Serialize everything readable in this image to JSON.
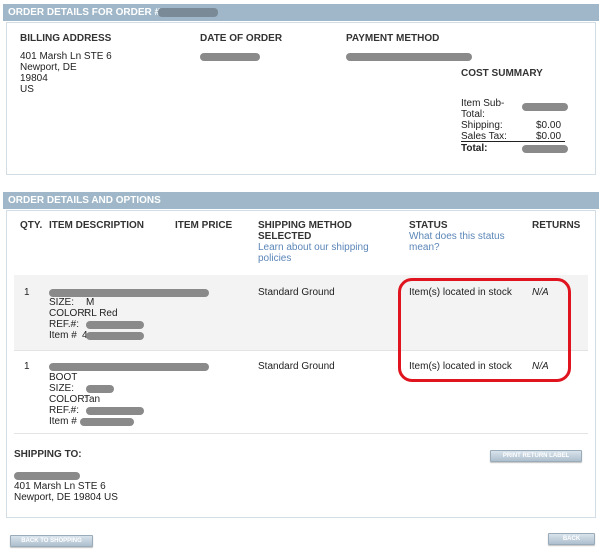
{
  "order_header": {
    "title": "ORDER DETAILS FOR ORDER #"
  },
  "summary": {
    "billing_label": "BILLING ADDRESS",
    "billing_lines": [
      "401 Marsh Ln STE 6",
      "Newport, DE",
      "19804",
      "US"
    ],
    "date_label": "DATE OF ORDER",
    "payment_label": "PAYMENT METHOD",
    "cost": {
      "title": "COST SUMMARY",
      "subtotal_label": "Item Sub-Total:",
      "shipping_label": "Shipping:",
      "shipping_value": "$0.00",
      "tax_label": "Sales Tax:",
      "tax_value": "$0.00",
      "total_label": "Total:"
    }
  },
  "options_header": {
    "title": "ORDER DETAILS AND OPTIONS"
  },
  "columns": {
    "qty": "QTY.",
    "desc": "ITEM DESCRIPTION",
    "price": "ITEM PRICE",
    "ship_method": "SHIPPING METHOD SELECTED",
    "ship_link": "Learn about our shipping policies",
    "status": "STATUS",
    "status_link": "What does this status mean?",
    "returns": "RETURNS"
  },
  "items": [
    {
      "qty": "1",
      "size_label": "SIZE:",
      "size_value": "M",
      "color_label": "COLOR:",
      "color_value": "RL Red",
      "ref_label": "REF.#:",
      "item_label": "Item #",
      "item_value": "4",
      "ship_method": "Standard Ground",
      "status": "Item(s) located in stock",
      "returns": "N/A"
    },
    {
      "qty": "1",
      "extra_line": "BOOT",
      "size_label": "SIZE:",
      "color_label": "COLOR:",
      "color_value": "Tan",
      "ref_label": "REF.#:",
      "item_label": "Item #",
      "ship_method": "Standard Ground",
      "status": "Item(s) located in stock",
      "returns": "N/A"
    }
  ],
  "shipping_to": {
    "label": "SHIPPING TO:",
    "lines": [
      "401 Marsh Ln STE 6",
      "Newport, DE  19804 US"
    ]
  },
  "buttons": {
    "print_return": "PRINT RETURN LABEL",
    "back_to_shopping": "BACK TO SHOPPING",
    "back": "BACK"
  },
  "colors": {
    "panel_header": "#9fb7c8",
    "link": "#5b86b8",
    "highlight": "#e0141e"
  }
}
